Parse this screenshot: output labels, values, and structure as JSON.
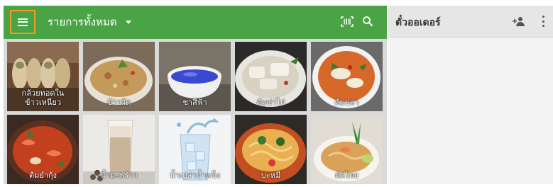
{
  "header": {
    "category_label": "รายการทั้งหมด"
  },
  "order_panel": {
    "title": "ตั๋วออเดอร์"
  },
  "icons": {
    "menu": "hamburger-icon",
    "dropdown": "caret-down-icon",
    "barcode": "barcode-scan-icon",
    "search": "search-icon",
    "add_customer": "add-person-icon",
    "more": "more-vert-icon"
  },
  "colors": {
    "topbar": "#4aa446",
    "menu_highlight": "#f39a26"
  },
  "items": [
    {
      "label": "กล้วยทอดใน\nข้าวเหนียว",
      "icon": "grilled-banana-sticky-rice"
    },
    {
      "label": "ข้าวผัด",
      "icon": "fried-rice"
    },
    {
      "label": "ชาสีฟ้า",
      "icon": "blue-tea"
    },
    {
      "label": "ต้มข่าไก่",
      "icon": "tom-kha-gai"
    },
    {
      "label": "ต้มปลา",
      "icon": "fish-soup"
    },
    {
      "label": "ต้มยำกุ้ง",
      "icon": "tom-yum-goong"
    },
    {
      "label": "น้ำมะพร้าว",
      "icon": "coconut-drink"
    },
    {
      "label": "น้ำเปล่าน้ำแข็ง",
      "icon": "iced-water"
    },
    {
      "label": "บะหมี่",
      "icon": "noodles"
    },
    {
      "label": "ผัดไทย",
      "icon": "pad-thai"
    }
  ]
}
